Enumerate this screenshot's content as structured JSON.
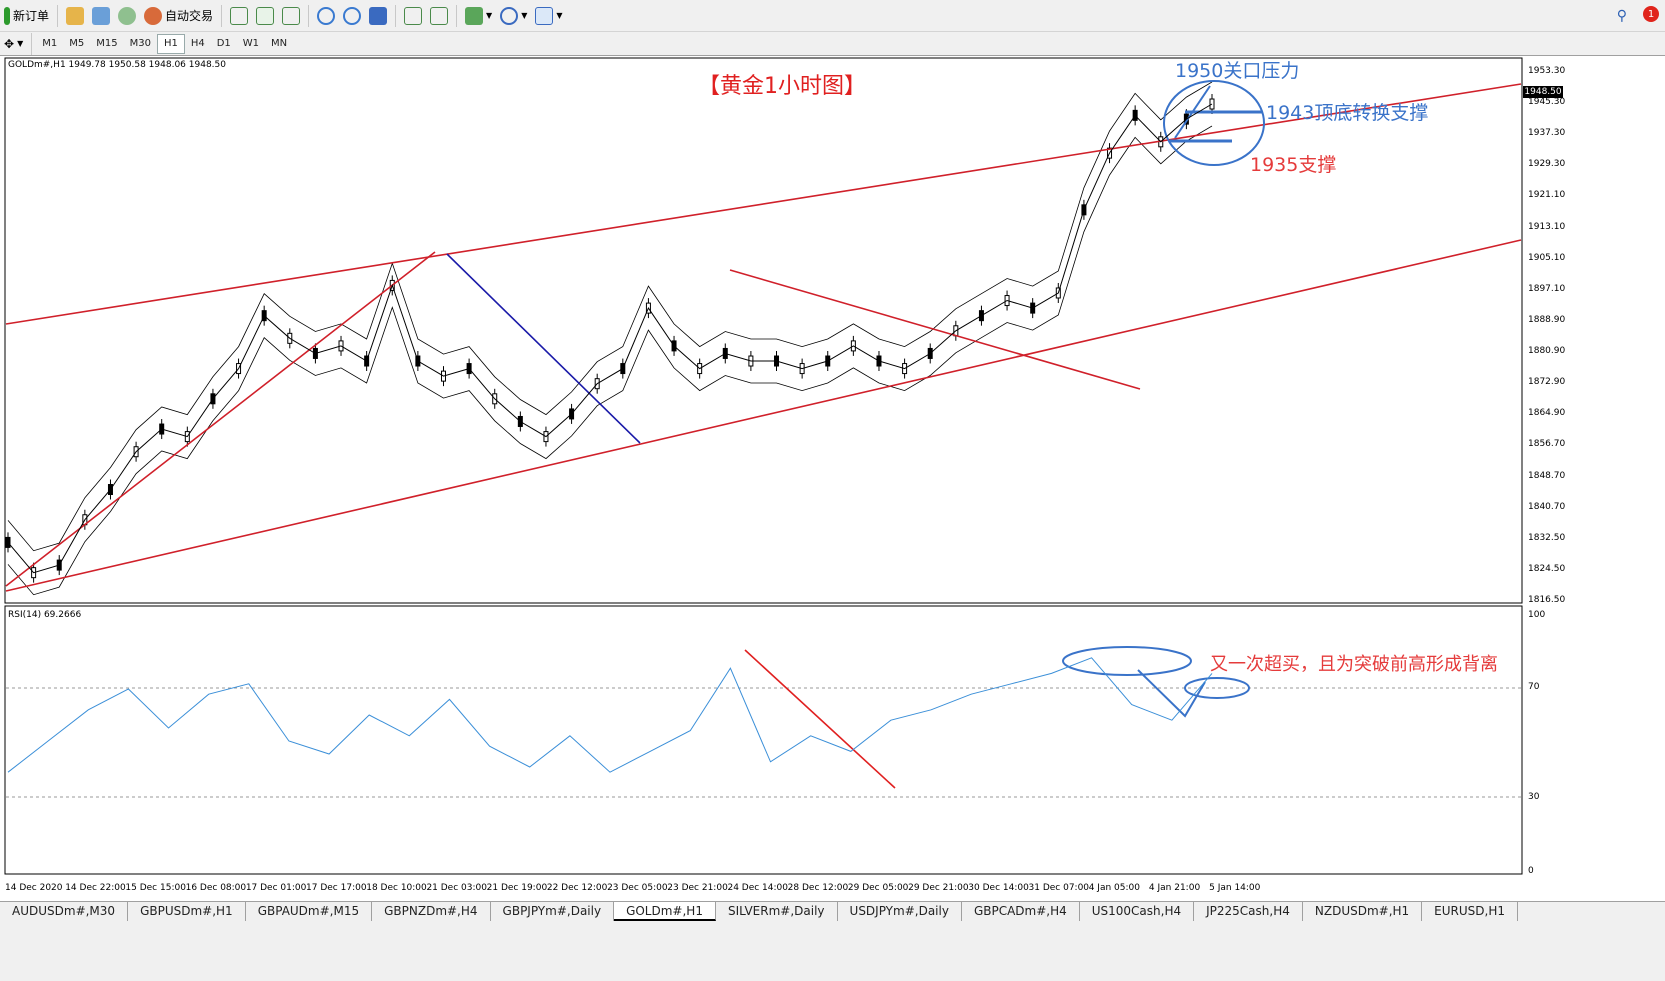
{
  "toolbar": {
    "new_order_label": "新订单",
    "auto_trade_label": "自动交易"
  },
  "timeframes": [
    "M1",
    "M5",
    "M15",
    "M30",
    "H1",
    "H4",
    "D1",
    "W1",
    "MN"
  ],
  "active_timeframe": "H1",
  "alert_count": "1",
  "chart": {
    "symbol_info": "GOLDm#,H1  1949.78 1950.58 1948.06 1948.50",
    "title": "【黄金1小时图】",
    "current_price": "1948.50",
    "rsi_info": "RSI(14) 69.2666"
  },
  "annotations": {
    "resistance_1950": "1950关口压力",
    "support_1943": "1943顶底转换支撑",
    "support_1935": "1935支撑",
    "rsi_note": "又一次超买，且为突破前高形成背离"
  },
  "price_axis": [
    "1953.30",
    "1945.30",
    "1937.30",
    "1929.30",
    "1921.10",
    "1913.10",
    "1905.10",
    "1897.10",
    "1888.90",
    "1880.90",
    "1872.90",
    "1864.90",
    "1856.70",
    "1848.70",
    "1840.70",
    "1832.50",
    "1824.50",
    "1816.50"
  ],
  "rsi_axis": [
    "100",
    "70",
    "30",
    "0"
  ],
  "time_axis": [
    "14 Dec 2020",
    "14 Dec 22:00",
    "15 Dec 15:00",
    "16 Dec 08:00",
    "17 Dec 01:00",
    "17 Dec 17:00",
    "18 Dec 10:00",
    "21 Dec 03:00",
    "21 Dec 19:00",
    "22 Dec 12:00",
    "23 Dec 05:00",
    "23 Dec 21:00",
    "24 Dec 14:00",
    "28 Dec 12:00",
    "29 Dec 05:00",
    "29 Dec 21:00",
    "30 Dec 14:00",
    "31 Dec 07:00",
    "4 Jan 05:00",
    "4 Jan 21:00",
    "5 Jan 14:00"
  ],
  "tabs": [
    "AUDUSDm#,M30",
    "GBPUSDm#,H1",
    "GBPAUDm#,M15",
    "GBPNZDm#,H4",
    "GBPJPYm#,Daily",
    "GOLDm#,H1",
    "SILVERm#,Daily",
    "USDJPYm#,Daily",
    "GBPCADm#,H4",
    "US100Cash,H4",
    "JP225Cash,H4",
    "NZDUSDm#,H1",
    "EURUSD,H1"
  ],
  "active_tab": "GOLDm#,H1",
  "colors": {
    "trendline": "#e02020",
    "channel_line": "#d0202a",
    "blue_line": "#1a1aa8",
    "annotation_blue": "#3a73c9",
    "rsi_line": "#3b8fd8"
  },
  "chart_data": {
    "type": "line",
    "series": [
      {
        "values": [
          1832,
          1824,
          1826,
          1838,
          1846,
          1856,
          1862,
          1860,
          1870,
          1878,
          1892,
          1886,
          1882,
          1884,
          1880,
          1900,
          1880,
          1876,
          1878,
          1870,
          1864,
          1860,
          1866,
          1874,
          1878,
          1894,
          1884,
          1878,
          1882,
          1880,
          1880,
          1878,
          1880,
          1884,
          1880,
          1878,
          1882,
          1888,
          1892,
          1896,
          1894,
          1898,
          1920,
          1935,
          1945,
          1938,
          1944,
          1948
        ]
      }
    ],
    "rsi": [
      38,
      50,
      62,
      70,
      55,
      68,
      72,
      50,
      45,
      60,
      52,
      66,
      48,
      40,
      52,
      38,
      46,
      54,
      78,
      42,
      52,
      46,
      58,
      62,
      68,
      72,
      76,
      82,
      64,
      58,
      76
    ],
    "ylim": [
      1816.5,
      1957
    ],
    "rsi_levels": [
      70,
      30
    ]
  }
}
